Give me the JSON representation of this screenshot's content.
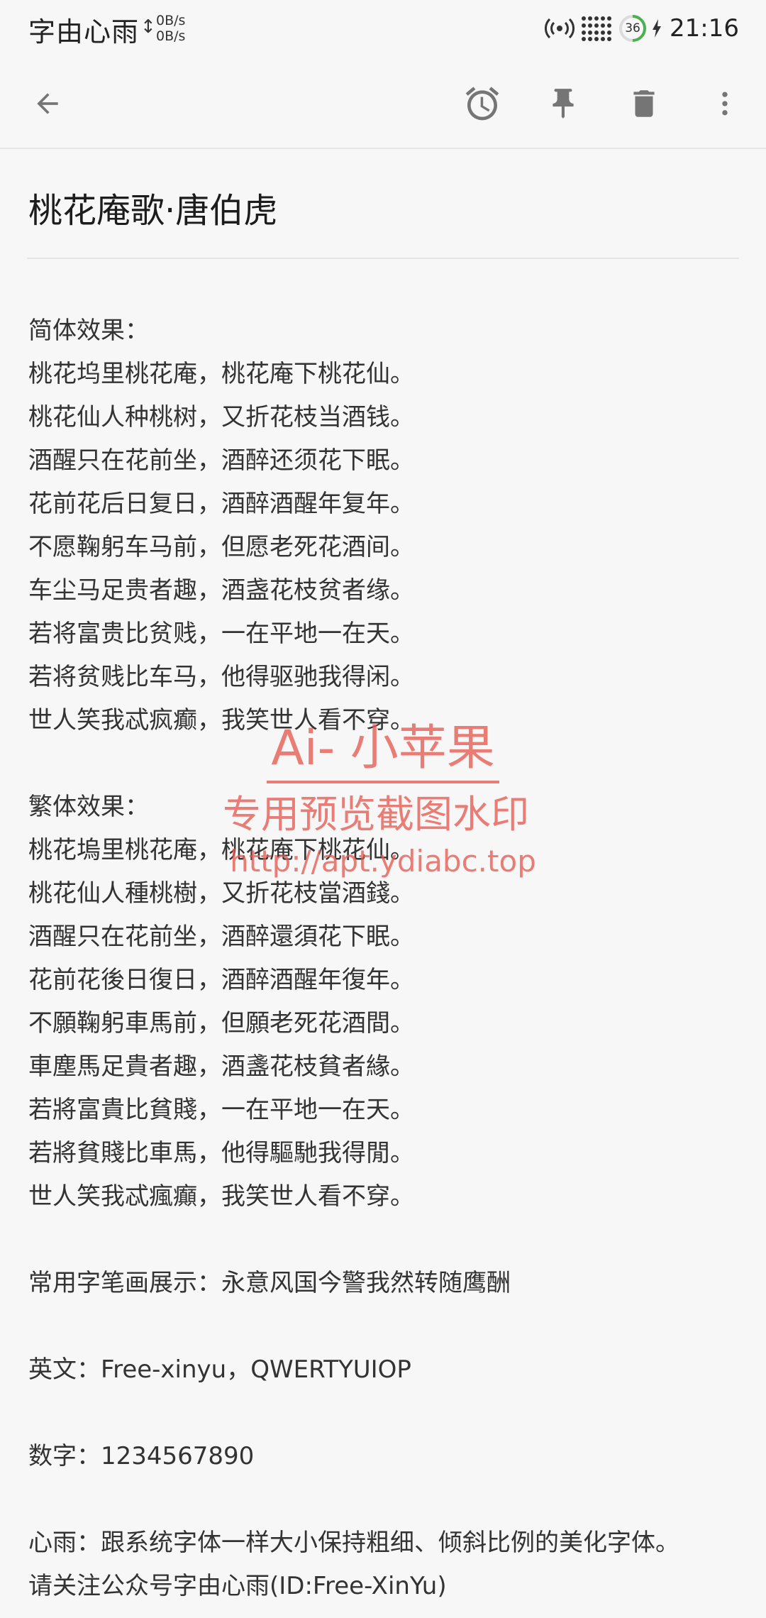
{
  "status_bar": {
    "carrier": "字由心雨",
    "net_up": "0B/s",
    "net_down": "0B/s",
    "battery": "36",
    "time": "21:16"
  },
  "toolbar": {
    "back_icon": "arrow-back-icon",
    "reminder_icon": "alarm-clock-icon",
    "pin_icon": "pin-icon",
    "delete_icon": "trash-icon",
    "more_icon": "more-vertical-icon"
  },
  "note": {
    "title": "桃花庵歌·唐伯虎",
    "lines": [
      "简体效果：",
      "桃花坞里桃花庵，桃花庵下桃花仙。",
      "桃花仙人种桃树，又折花枝当酒钱。",
      "酒醒只在花前坐，酒醉还须花下眠。",
      "花前花后日复日，酒醉酒醒年复年。",
      "不愿鞠躬车马前，但愿老死花酒间。",
      "车尘马足贵者趣，酒盏花枝贫者缘。",
      "若将富贵比贫贱，一在平地一在天。",
      "若将贫贱比车马，他得驱驰我得闲。",
      "世人笑我忒疯癫，我笑世人看不穿。",
      "",
      "繁体效果：",
      "桃花塢里桃花庵，桃花庵下桃花仙。",
      "桃花仙人種桃樹，又折花枝當酒錢。",
      "酒醒只在花前坐，酒醉還須花下眠。",
      "花前花後日復日，酒醉酒醒年復年。",
      "不願鞠躬車馬前，但願老死花酒間。",
      "車塵馬足貴者趣，酒盞花枝貧者緣。",
      "若將富貴比貧賤，一在平地一在天。",
      "若將貧賤比車馬，他得驅馳我得閒。",
      "世人笑我忒瘋癲，我笑世人看不穿。",
      "",
      "常用字笔画展示：永意风国今警我然转随鹰酬",
      "",
      "英文：Free-xinyu，QWERTYUIOP",
      "",
      "数字：1234567890",
      "",
      "心雨：跟系统字体一样大小保持粗细、倾斜比例的美化字体。",
      "请关注公众号字由心雨(ID:Free-XinYu)"
    ]
  },
  "watermark": {
    "title": "Ai- 小苹果",
    "subtitle": "专用预览截图水印",
    "url": "http://apt.ydiabc.top"
  },
  "colors": {
    "background": "#f7f7f7",
    "icon": "#757575",
    "watermark": "#e65a50",
    "battery_ring": "#4caf50"
  }
}
